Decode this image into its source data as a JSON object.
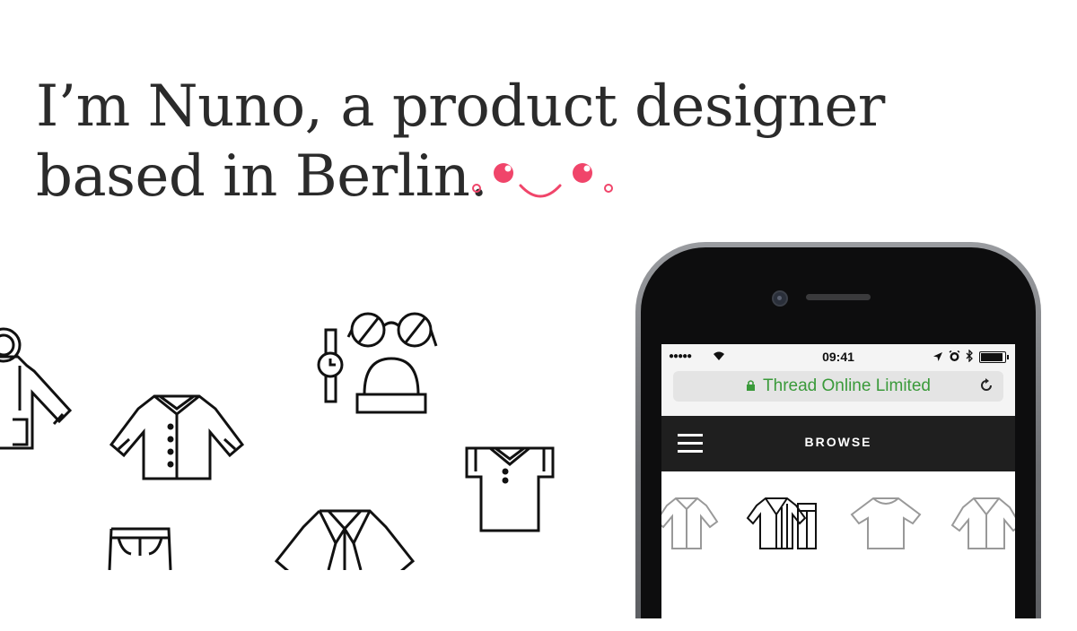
{
  "hero": {
    "line1": "I’m Nuno, a product designer",
    "line2": "based in Berlin.",
    "accent_color": "#f0456a"
  },
  "illustrations": [
    {
      "icon": "hooded-jacket-icon"
    },
    {
      "icon": "shirt-icon"
    },
    {
      "icon": "watch-icon"
    },
    {
      "icon": "glasses-icon"
    },
    {
      "icon": "beanie-icon"
    },
    {
      "icon": "polo-shirt-icon"
    },
    {
      "icon": "trousers-icon"
    },
    {
      "icon": "blazer-icon"
    }
  ],
  "phone": {
    "status": {
      "signal": "●●●●●",
      "time": "09:41"
    },
    "address_bar": {
      "site": "Thread Online Limited",
      "secure_color": "#3a9a3a"
    },
    "nav": {
      "title": "BROWSE"
    }
  }
}
